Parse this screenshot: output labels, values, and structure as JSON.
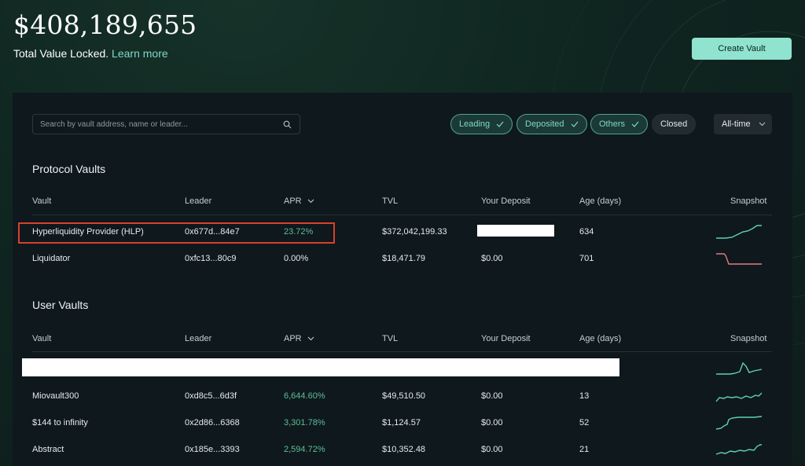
{
  "header": {
    "tvl_amount": "$408,189,655",
    "tvl_label": "Total Value Locked.",
    "learn_more": "Learn more",
    "create_vault": "Create Vault"
  },
  "search": {
    "placeholder": "Search by vault address, name or leader..."
  },
  "filters": [
    {
      "label": "Leading",
      "checked": true
    },
    {
      "label": "Deposited",
      "checked": true
    },
    {
      "label": "Others",
      "checked": true
    },
    {
      "label": "Closed",
      "checked": false
    }
  ],
  "time_filter": "All-time",
  "columns": {
    "vault": "Vault",
    "leader": "Leader",
    "apr": "APR",
    "tvl": "TVL",
    "deposit": "Your Deposit",
    "age": "Age (days)",
    "snapshot": "Snapshot"
  },
  "protocol_vaults": {
    "title": "Protocol Vaults",
    "rows": [
      {
        "name": "Hyperliquidity Provider (HLP)",
        "leader": "0x677d...84e7",
        "apr": "23.72%",
        "tvl": "$372,042,199.33",
        "deposit": "",
        "age": "634",
        "snapshot_trend": "up",
        "snapshot_color": "#5fd0b8"
      },
      {
        "name": "Liquidator",
        "leader": "0xfc13...80c9",
        "apr": "0.00%",
        "tvl": "$18,471.79",
        "deposit": "$0.00",
        "age": "701",
        "snapshot_trend": "down",
        "snapshot_color": "#e07a84"
      }
    ]
  },
  "user_vaults": {
    "title": "User Vaults",
    "rows": [
      {
        "name": "",
        "leader": "",
        "apr": "",
        "tvl": "",
        "deposit": "",
        "age": "",
        "snapshot_trend": "spike",
        "snapshot_color": "#5fd0b8"
      },
      {
        "name": "Miovault300",
        "leader": "0xd8c5...6d3f",
        "apr": "6,644.60%",
        "tvl": "$49,510.50",
        "deposit": "$0.00",
        "age": "13",
        "snapshot_trend": "wavy",
        "snapshot_color": "#5fd0b8"
      },
      {
        "name": "$144 to infinity",
        "leader": "0x2d86...6368",
        "apr": "3,301.78%",
        "tvl": "$1,124.57",
        "deposit": "$0.00",
        "age": "52",
        "snapshot_trend": "step",
        "snapshot_color": "#5fd0b8"
      },
      {
        "name": "Abstract",
        "leader": "0x185e...3393",
        "apr": "2,594.72%",
        "tvl": "$10,352.48",
        "deposit": "$0.00",
        "age": "21",
        "snapshot_trend": "rise",
        "snapshot_color": "#5fd0b8"
      }
    ]
  },
  "colors": {
    "accent": "#8fe3cf",
    "positive": "#5fbf94",
    "negative": "#e07a84",
    "highlight": "#d8412c"
  }
}
